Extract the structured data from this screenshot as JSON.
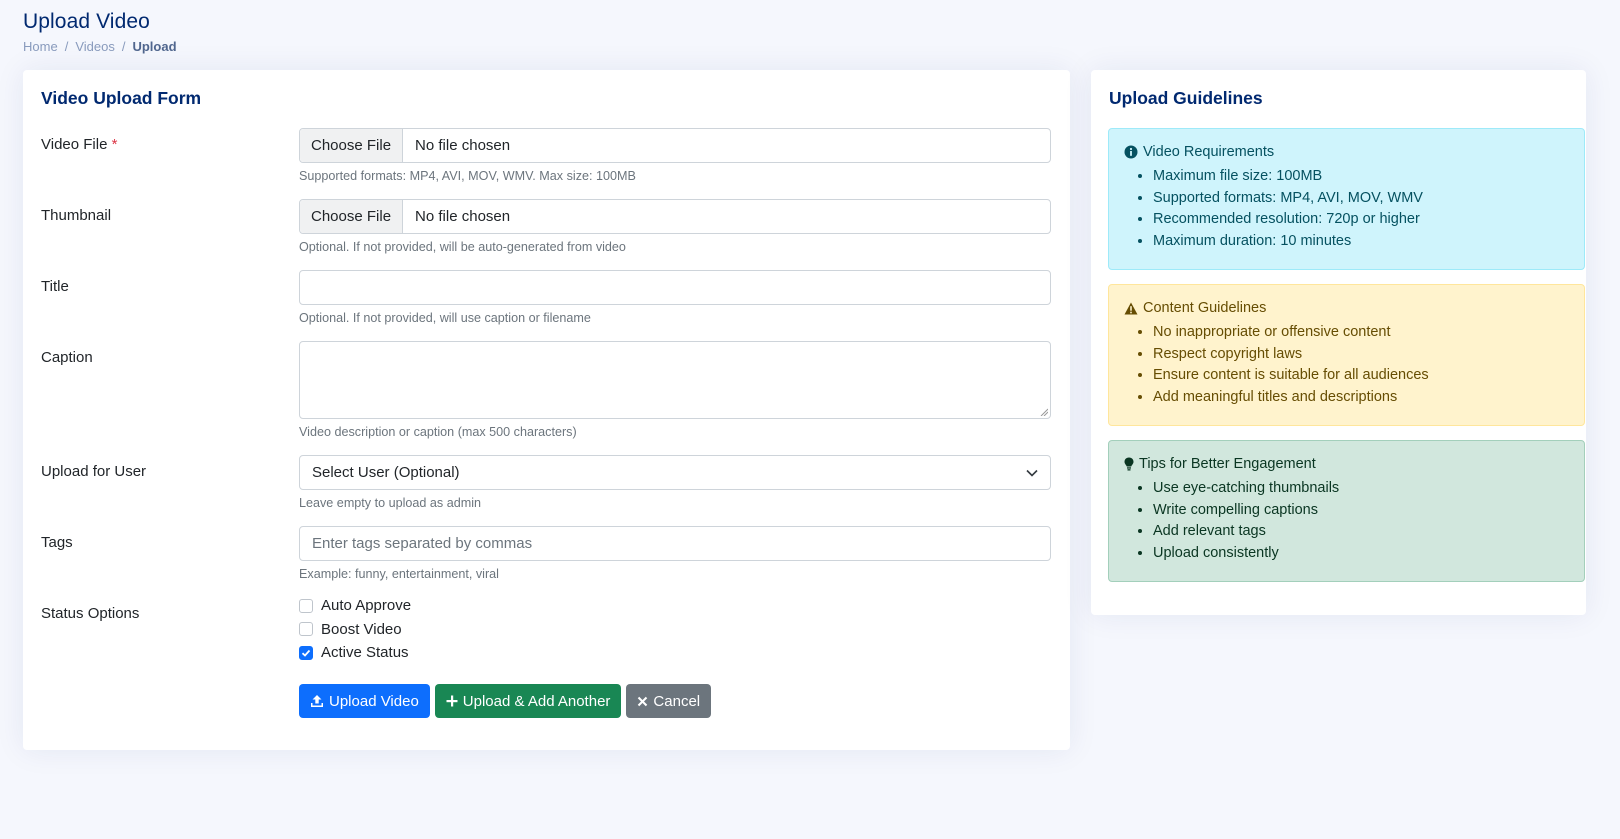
{
  "header": {
    "title": "Upload Video",
    "breadcrumb": [
      "Home",
      "Videos",
      "Upload"
    ]
  },
  "form": {
    "title": "Video Upload Form",
    "video_file": {
      "label": "Video File",
      "required_mark": "*",
      "button": "Choose File",
      "value": "No file chosen",
      "help": "Supported formats: MP4, AVI, MOV, WMV. Max size: 100MB"
    },
    "thumbnail": {
      "label": "Thumbnail",
      "button": "Choose File",
      "value": "No file chosen",
      "help": "Optional. If not provided, will be auto-generated from video"
    },
    "title_field": {
      "label": "Title",
      "value": "",
      "help": "Optional. If not provided, will use caption or filename"
    },
    "caption": {
      "label": "Caption",
      "value": "",
      "help": "Video description or caption (max 500 characters)"
    },
    "upload_for_user": {
      "label": "Upload for User",
      "selected": "Select User (Optional)",
      "help": "Leave empty to upload as admin"
    },
    "tags": {
      "label": "Tags",
      "placeholder": "Enter tags separated by commas",
      "help": "Example: funny, entertainment, viral"
    },
    "status": {
      "label": "Status Options",
      "options": [
        {
          "label": "Auto Approve",
          "checked": false
        },
        {
          "label": "Boost Video",
          "checked": false
        },
        {
          "label": "Active Status",
          "checked": true
        }
      ]
    },
    "buttons": {
      "upload": "Upload Video",
      "upload_add": "Upload & Add Another",
      "cancel": "Cancel"
    }
  },
  "guidelines": {
    "title": "Upload Guidelines",
    "requirements": {
      "title": "Video Requirements",
      "items": [
        "Maximum file size: 100MB",
        "Supported formats: MP4, AVI, MOV, WMV",
        "Recommended resolution: 720p or higher",
        "Maximum duration: 10 minutes"
      ]
    },
    "content": {
      "title": "Content Guidelines",
      "items": [
        "No inappropriate or offensive content",
        "Respect copyright laws",
        "Ensure content is suitable for all audiences",
        "Add meaningful titles and descriptions"
      ]
    },
    "tips": {
      "title": "Tips for Better Engagement",
      "items": [
        "Use eye-catching thumbnails",
        "Write compelling captions",
        "Add relevant tags",
        "Upload consistently"
      ]
    }
  },
  "colors": {
    "primary": "#0d6efd",
    "success": "#198754",
    "secondary": "#6c757d",
    "heading": "#012970"
  }
}
